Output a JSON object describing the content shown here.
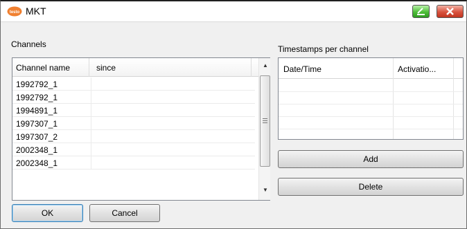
{
  "window": {
    "title": "MKT",
    "app_icon": "testo-logo-icon",
    "app_icon_text": "testo",
    "minimize_icon": "restore-icon",
    "close_icon": "close-icon"
  },
  "channels": {
    "label": "Channels",
    "columns": [
      "Channel name",
      "since"
    ],
    "rows": [
      {
        "name": "1992792_1",
        "since": ""
      },
      {
        "name": "1992792_1",
        "since": ""
      },
      {
        "name": "1994891_1",
        "since": ""
      },
      {
        "name": "1997307_1",
        "since": ""
      },
      {
        "name": "1997307_2",
        "since": ""
      },
      {
        "name": "2002348_1",
        "since": ""
      },
      {
        "name": "2002348_1",
        "since": ""
      }
    ]
  },
  "timestamps": {
    "label": "Timestamps per channel",
    "columns": [
      "Date/Time",
      "Activatio..."
    ]
  },
  "buttons": {
    "add": "Add",
    "delete": "Delete",
    "ok": "OK",
    "cancel": "Cancel"
  },
  "colors": {
    "minimize": "#4fbf3a",
    "close": "#d8533f",
    "app_icon": "#f08030"
  }
}
